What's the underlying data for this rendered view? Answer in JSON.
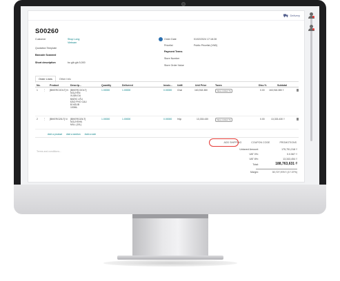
{
  "top_bar": {
    "smart_button_label": "Delivery"
  },
  "order": {
    "name": "S00260",
    "fields_left": [
      {
        "label": "Customer",
        "value": "Shop Long\nVietnam",
        "link": true
      },
      {
        "label": "Quotation Template",
        "value": ""
      },
      {
        "label": "Barcode Scanned",
        "value": "",
        "bold": true
      },
      {
        "label": "Short description",
        "value": "bo giả giá 5,000",
        "bold": true
      }
    ],
    "fields_right": [
      {
        "label": "Order Date",
        "value": "01/02/2024 17:18:28"
      },
      {
        "label": "Pricelist",
        "value": "Public Pricelist (VND)"
      },
      {
        "label": "Payment Terms",
        "value": "",
        "bold": true
      },
      {
        "label": "Store Number",
        "value": ""
      },
      {
        "label": "Store Order Value",
        "value": ""
      }
    ]
  },
  "tabs": [
    "Order Lines",
    "Other Info"
  ],
  "table": {
    "headers": [
      "No.",
      "Product",
      "Descrip...",
      "Quantity",
      "Delivered",
      "Invoic...",
      "UoM",
      "Unit Price",
      "Taxes",
      "Disc.%",
      "Subtotal"
    ],
    "rows": [
      {
        "no": "1",
        "product": "[BIKERCOOLT] N",
        "description": [
          "[BIKERCOOLT]",
          "NGUYÊN",
          "XUÂN DU",
          "BAÍHC LÊU",
          "ĐÀO PHO CAU",
          "B.NGUB",
          "100ML"
        ],
        "quantity": "1.00000",
        "delivered": "1.00000",
        "invoiced": "0.00000",
        "uom": "Chai",
        "unit_price": "163,918.380",
        "taxes": "Value Added Ta",
        "discount": "0.00",
        "subtotal": "163,918.380 ₫"
      },
      {
        "no": "2",
        "product": "[BIKERG20LT] N",
        "description": [
          "[BIKERG20LT]",
          "NGUYEHN",
          "MILL (10L)"
        ],
        "quantity": "1.00000",
        "delivered": "1.00000",
        "invoiced": "0.00000",
        "uom": "Hộp",
        "unit_price": "13,333.430",
        "taxes": "Value Added Ta",
        "discount": "0.00",
        "subtotal": "13,333.430 ₫"
      }
    ],
    "add_links": [
      "Add a product",
      "Add a section",
      "Add a note"
    ]
  },
  "footer_buttons": [
    "ADD SHIPPING",
    "COUPON CODE",
    "PROMOTIONS"
  ],
  "terms_placeholder": "Terms and conditions...",
  "totals": [
    {
      "label": "Untaxed Amount:",
      "value": "175,751,318 ₫"
    },
    {
      "label": "VAT 0%:",
      "value": "0.0.567 ₫"
    },
    {
      "label": "VAT 8%:",
      "value": "13,343,454 ₫"
    },
    {
      "label": "Total:",
      "value": "188,763,631 ₫",
      "big": true
    },
    {
      "label": "Margin:",
      "value": "30,727,978 ₫ (17.37%)"
    }
  ],
  "colors": {
    "link": "#017e84",
    "highlight": "#e53935",
    "gear": "#2a6fb0"
  }
}
